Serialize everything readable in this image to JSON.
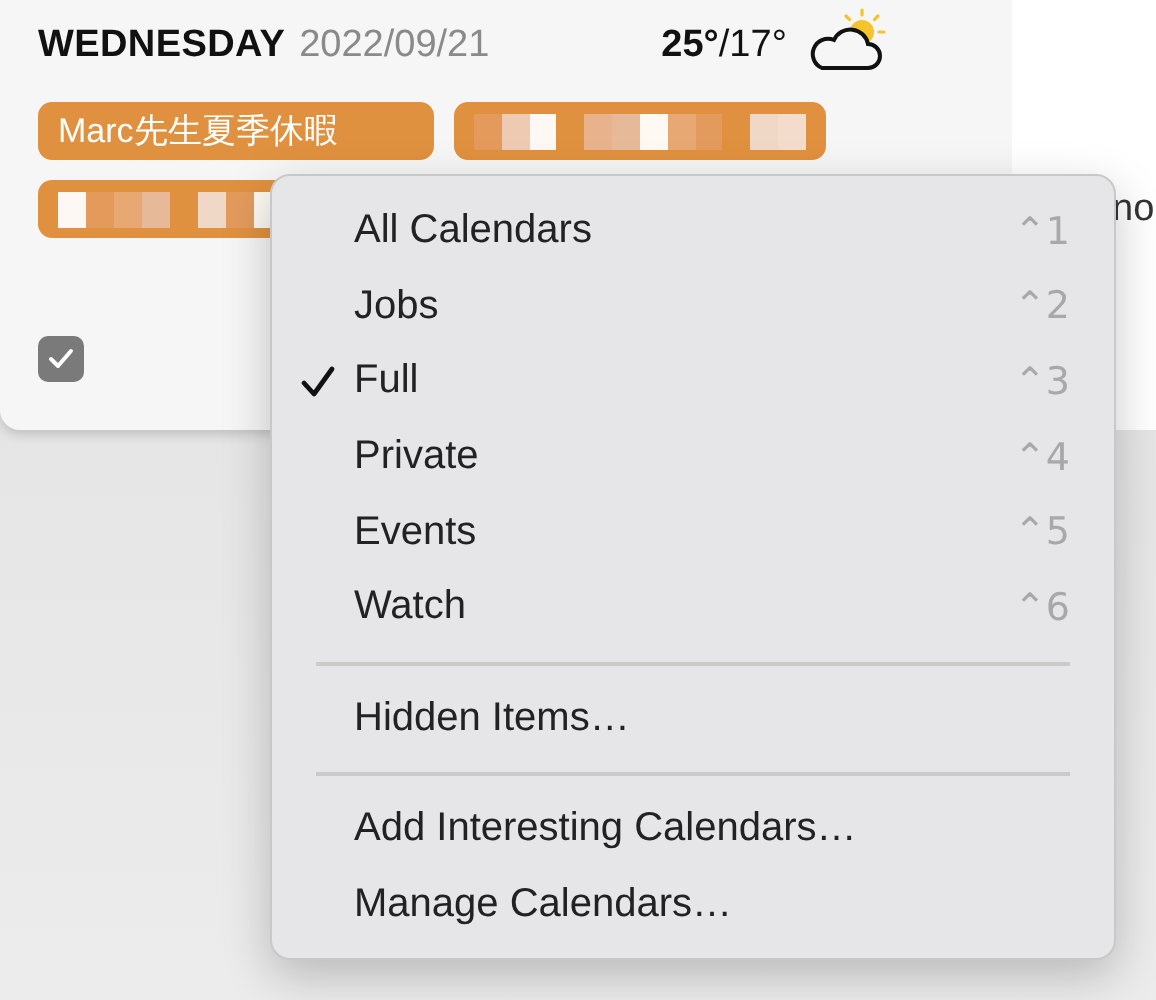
{
  "day": {
    "weekday": "WEDNESDAY",
    "date": "2022/09/21",
    "high": "25°",
    "low": "/17°"
  },
  "events": [
    {
      "kind": "label",
      "label": "Marc先生夏季休暇"
    },
    {
      "kind": "obscured"
    },
    {
      "kind": "obscured"
    }
  ],
  "reminder": {
    "checked": true
  },
  "side_panel": {
    "text": "no"
  },
  "menu": {
    "items": [
      {
        "kind": "option",
        "label": "All Calendars",
        "shortcut": "⌃1",
        "selected": false
      },
      {
        "kind": "option",
        "label": "Jobs",
        "shortcut": "⌃2",
        "selected": false
      },
      {
        "kind": "option",
        "label": "Full",
        "shortcut": "⌃3",
        "selected": true
      },
      {
        "kind": "option",
        "label": "Private",
        "shortcut": "⌃4",
        "selected": false
      },
      {
        "kind": "option",
        "label": "Events",
        "shortcut": "⌃5",
        "selected": false
      },
      {
        "kind": "option",
        "label": "Watch",
        "shortcut": "⌃6",
        "selected": false
      },
      {
        "kind": "separator"
      },
      {
        "kind": "action",
        "label": "Hidden Items…"
      },
      {
        "kind": "separator"
      },
      {
        "kind": "action",
        "label": "Add Interesting Calendars…"
      },
      {
        "kind": "action",
        "label": "Manage Calendars…"
      }
    ]
  }
}
